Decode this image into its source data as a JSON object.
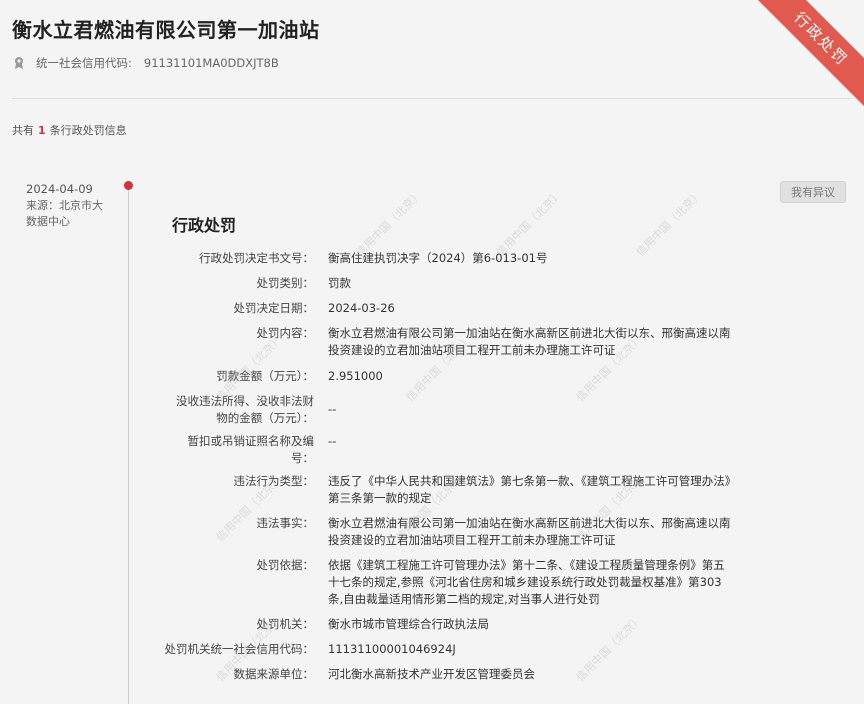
{
  "company": {
    "name": "衡水立君燃油有限公司第一加油站",
    "credit_code_label": "统一社会信用代码:",
    "credit_code": "91131101MA0DDXJT8B"
  },
  "ribbon": "行政处罚",
  "summary": {
    "prefix": "共有",
    "count": "1",
    "suffix": "条行政处罚信息"
  },
  "record": {
    "date": "2024-04-09",
    "source": "来源：北京市大数据中心",
    "objection_label": "我有异议",
    "section_title": "行政处罚",
    "fields": [
      {
        "key": "行政处罚决定书文号",
        "value": "衡高住建执罚决字（2024）第6-013-01号"
      },
      {
        "key": "处罚类别",
        "value": "罚款"
      },
      {
        "key": "处罚决定日期",
        "value": "2024-03-26"
      },
      {
        "key": "处罚内容",
        "value": "衡水立君燃油有限公司第一加油站在衡水高新区前进北大街以东、邢衡高速以南投资建设的立君加油站项目工程开工前未办理施工许可证"
      },
      {
        "key": "罚款金额（万元）",
        "value": "2.951000"
      },
      {
        "key": "没收违法所得、没收非法财物的金额（万元）",
        "value": "--"
      },
      {
        "key": "暂扣或吊销证照名称及编号",
        "value": "--"
      },
      {
        "key": "违法行为类型",
        "value": "违反了《中华人民共和国建筑法》第七条第一款、《建筑工程施工许可管理办法》第三条第一款的规定"
      },
      {
        "key": "违法事实",
        "value": "衡水立君燃油有限公司第一加油站在衡水高新区前进北大街以东、邢衡高速以南投资建设的立君加油站项目工程开工前未办理施工许可证"
      },
      {
        "key": "处罚依据",
        "value": "依据《建筑工程施工许可管理办法》第十二条、《建设工程质量管理条例》第五十七条的规定,参照《河北省住房和城乡建设系统行政处罚裁量权基准》第303条,自由裁量适用情形第二档的规定,对当事人进行处罚"
      },
      {
        "key": "处罚机关",
        "value": "衡水市城市管理综合行政执法局"
      },
      {
        "key": "处罚机关统一社会信用代码",
        "value": "11131100001046924J"
      },
      {
        "key": "数据来源单位",
        "value": "河北衡水高新技术产业开发区管理委员会"
      }
    ]
  },
  "watermark": "信用中国（北京）"
}
